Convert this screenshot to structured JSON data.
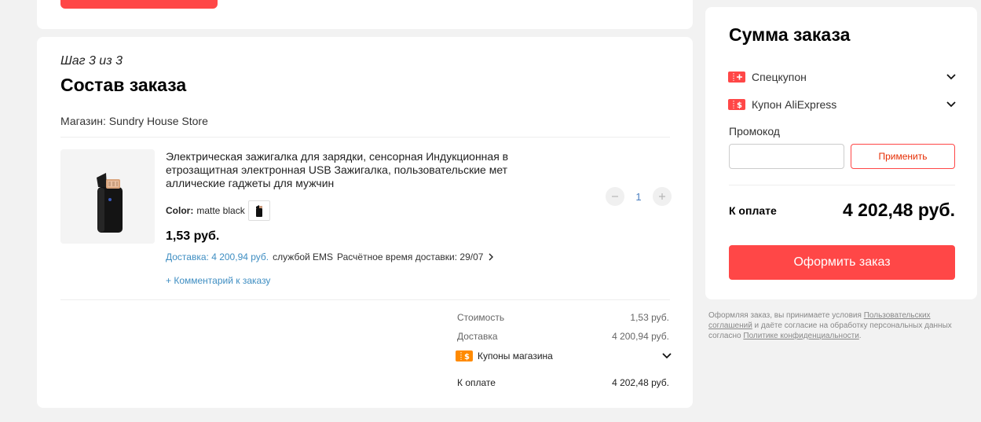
{
  "step": {
    "text": "Шаг 3 из 3"
  },
  "order": {
    "title": "Состав заказа",
    "store": "Магазин: Sundry House Store"
  },
  "product": {
    "title": "Электрическая зажигалка для зарядки, сенсорная Индукционная в етрозащитная электронная USB Зажигалка, пользовательские мет аллические гаджеты для мужчин",
    "color_label": "Color:",
    "color_value": "matte black",
    "price": "1,53 руб.",
    "delivery_price": "Доставка: 4 200,94 руб.",
    "delivery_service": "службой EMS",
    "delivery_time": "Расчётное время доставки: 29/07",
    "comment": "+ Комментарий к заказу",
    "quantity": "1"
  },
  "store_summary": {
    "cost_label": "Стоимость",
    "cost_value": "1,53 руб.",
    "shipping_label": "Доставка",
    "shipping_value": "4 200,94 руб.",
    "coupons_label": "Купоны магазина",
    "total_label": "К оплате",
    "total_value": "4 202,48 руб."
  },
  "sidebar": {
    "title": "Сумма заказа",
    "special_coupon": "Спецкупон",
    "ali_coupon": "Купон AliExpress",
    "promo_label": "Промокод",
    "promo_placeholder": "",
    "apply_label": "Применить",
    "total_label": "К оплате",
    "total_value": "4 202,48 руб.",
    "checkout_label": "Оформить заказ"
  },
  "legal": {
    "part1": "Оформляя заказ, вы принимаете условия ",
    "link1": "Пользовательских соглашений",
    "part2": " и даёте согласие на обработку персональных данных согласно ",
    "link2": "Политике конфиденциальности",
    "part3": "."
  },
  "colors": {
    "accent": "#ff4747",
    "link": "#3f8ec2",
    "coupon_orange": "#ff8a00",
    "background": "#f2f2f2"
  },
  "icons": {
    "special_coupon": "special-coupon-icon",
    "ali_coupon": "ali-coupon-icon",
    "shop_coupon": "shop-coupon-icon",
    "chevron": "chevron-down-icon",
    "chevron_right": "chevron-right-icon"
  }
}
